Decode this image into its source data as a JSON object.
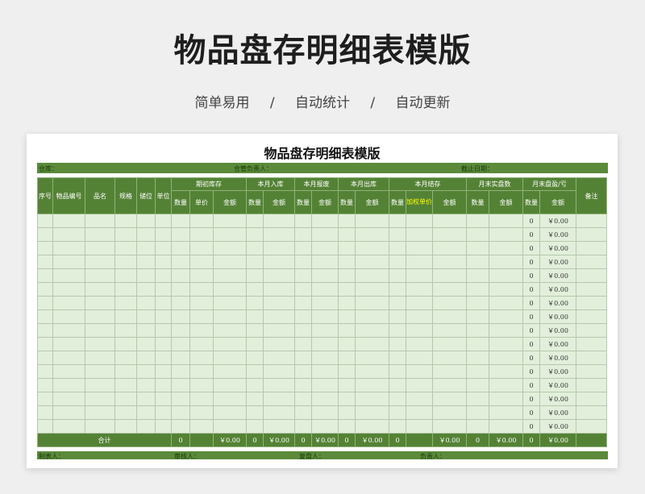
{
  "banner": {
    "title": "物品盘存明细表模版",
    "subtitle": [
      "简单易用",
      "/",
      "自动统计",
      "/",
      "自动更新"
    ]
  },
  "sheet": {
    "title": "物品盘存明细表模版",
    "meta": {
      "warehouse": "仓库：",
      "manager": "仓管负责人：",
      "deadline": "截止日期："
    },
    "headers": {
      "seq": "序号",
      "code": "物品编号",
      "name": "品名",
      "spec": "规格",
      "slot": "储位",
      "unit": "单位",
      "opening": "期初库存",
      "in": "本月入库",
      "scrap": "本月报废",
      "out": "本月出库",
      "closing": "本月结存",
      "actual": "月末实盘数",
      "diff": "月末盘盈/亏",
      "remark": "备注",
      "qty": "数量",
      "price": "单价",
      "amount": "金额",
      "weighted_price": "加权单价"
    },
    "row_values": {
      "qty": "0",
      "amount": "￥0.00"
    },
    "total": {
      "label": "合计",
      "opening_qty": "0",
      "opening_amount": "￥0.00",
      "in_qty": "0",
      "in_amount": "￥0.00",
      "scrap_qty": "0",
      "scrap_amount": "￥0.00",
      "out_qty": "0",
      "out_amount": "￥0.00",
      "closing_qty": "0",
      "closing_amount": "￥0.00",
      "actual_qty": "0",
      "actual_amount": "￥0.00",
      "diff_qty": "0",
      "diff_amount": "￥0.00"
    },
    "footer": [
      "制表人：",
      "审核人：",
      "复盘人：",
      "负责人："
    ]
  },
  "colors": {
    "header_green": "#548235",
    "row_green": "#e2efda",
    "weighted_price_text": "#ffff00"
  }
}
